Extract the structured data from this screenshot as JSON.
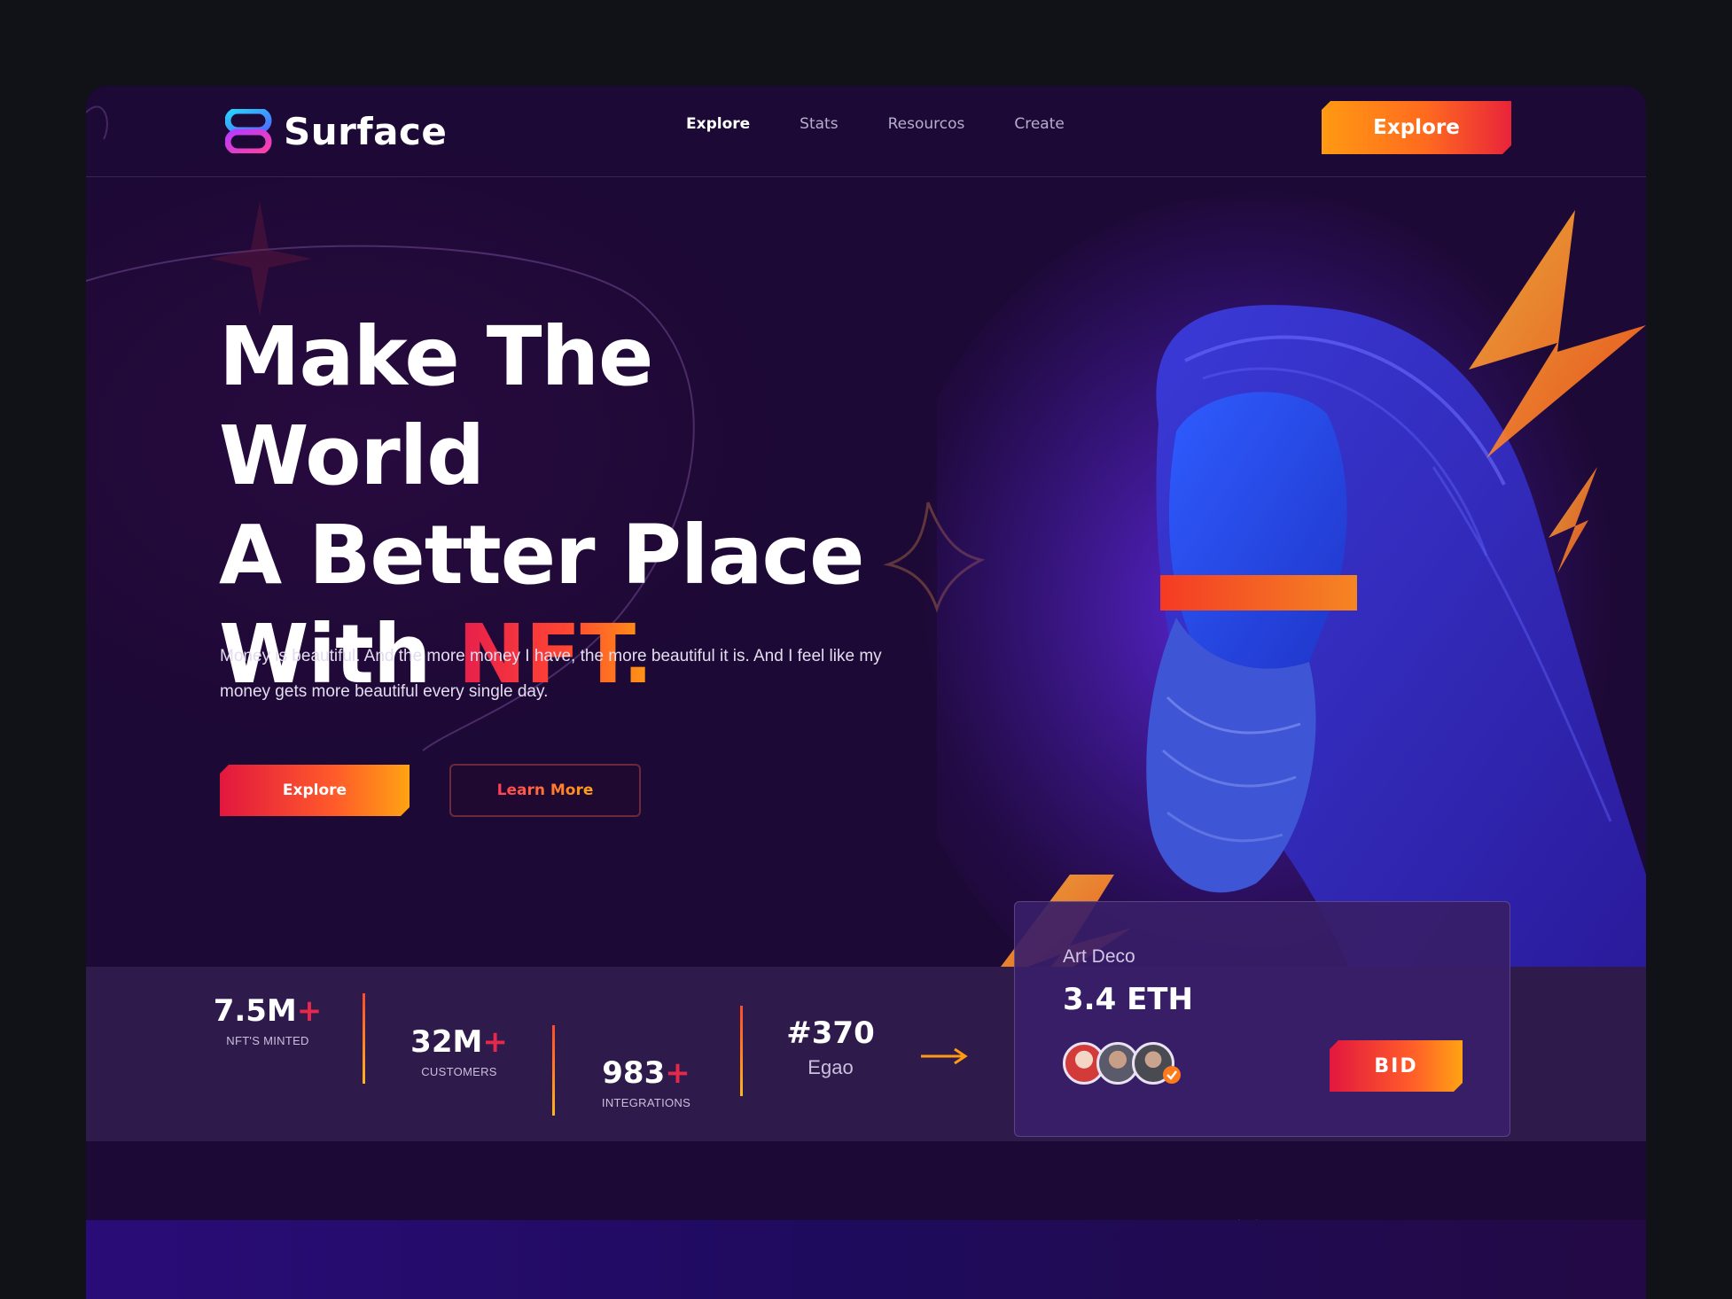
{
  "brand": {
    "name": "Surface"
  },
  "nav": {
    "items": [
      "Explore",
      "Stats",
      "Resourcos",
      "Create"
    ],
    "cta_label": "Explore"
  },
  "hero": {
    "line1": "Make The World",
    "line2": "A Better Place",
    "line3_prefix": "With ",
    "highlight": "NFT.",
    "description": "Money is beautiful. And the more money I have, the more beautiful it is. And I feel like my money gets more beautiful every single day.",
    "primary_button": "Explore",
    "secondary_button": "Learn More"
  },
  "stats": [
    {
      "value": "7.5M",
      "suffix": "+",
      "label": "NFT'S MINTED"
    },
    {
      "value": "32M",
      "suffix": "+",
      "label": "CUSTOMERS"
    },
    {
      "value": "983",
      "suffix": "+",
      "label": "INTEGRATIONS"
    }
  ],
  "featured": {
    "number": "#370",
    "name": "Egao"
  },
  "card": {
    "title": "Art Deco",
    "price": "3.4 ETH",
    "bid_label": "BID"
  },
  "colors": {
    "accent_orange": "#ff9a12",
    "accent_red": "#e2173f",
    "background": "#1d0935",
    "stats_bar": "#2f1a4c"
  },
  "icons": [
    "logo-icon",
    "arrow-right-icon",
    "verified-badge-icon",
    "sparkle-star-icon",
    "lightning-bolt-icon"
  ]
}
